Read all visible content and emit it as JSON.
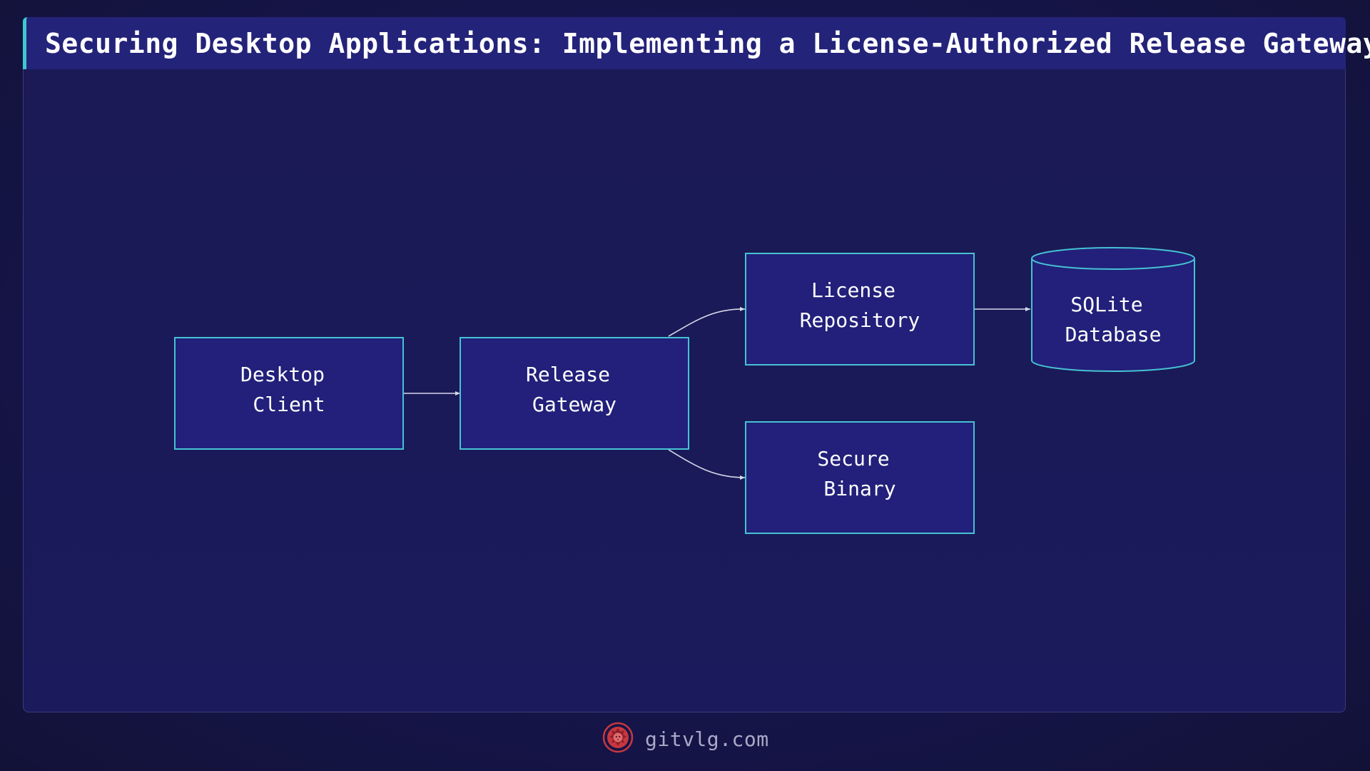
{
  "title": "Securing Desktop Applications: Implementing a License-Authorized Release Gateway",
  "colors": {
    "background": "#14143a",
    "panel": "#1a1a58",
    "title_bar": "#24237a",
    "accent": "#3dc8d0",
    "node_fill": "#22207a",
    "node_stroke": "#46c2d2",
    "edge": "#d8d8ea",
    "footer_text": "#a8aac8",
    "logo": "#c8373f"
  },
  "nodes": {
    "desktop_client": {
      "line1": "Desktop",
      "line2": "Client"
    },
    "release_gateway": {
      "line1": "Release",
      "line2": "Gateway"
    },
    "license_repository": {
      "line1": "License",
      "line2": "Repository"
    },
    "sqlite_database": {
      "line1": "SQLite",
      "line2": "Database",
      "shape": "cylinder"
    },
    "secure_binary": {
      "line1": "Secure",
      "line2": "Binary"
    }
  },
  "edges": [
    {
      "from": "desktop_client",
      "to": "release_gateway"
    },
    {
      "from": "release_gateway",
      "to": "license_repository"
    },
    {
      "from": "release_gateway",
      "to": "secure_binary"
    },
    {
      "from": "license_repository",
      "to": "sqlite_database"
    }
  ],
  "footer": {
    "logo_icon": "lion-head-icon",
    "site": "gitvlg.com"
  }
}
